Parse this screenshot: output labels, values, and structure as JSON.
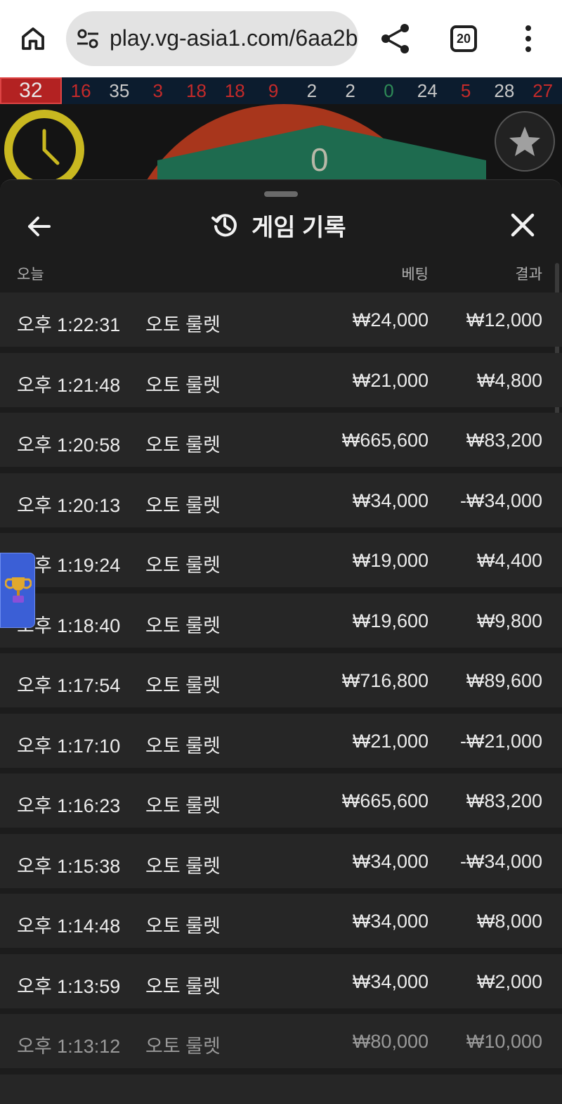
{
  "browser": {
    "url": "play.vg-asia1.com/6aa2b",
    "tab_count": "20"
  },
  "results_strip": {
    "latest": "32",
    "numbers": [
      {
        "value": "16",
        "color": "red"
      },
      {
        "value": "35",
        "color": "black"
      },
      {
        "value": "3",
        "color": "red"
      },
      {
        "value": "18",
        "color": "red"
      },
      {
        "value": "18",
        "color": "red"
      },
      {
        "value": "9",
        "color": "red"
      },
      {
        "value": "2",
        "color": "black"
      },
      {
        "value": "2",
        "color": "black"
      },
      {
        "value": "0",
        "color": "green"
      },
      {
        "value": "24",
        "color": "black"
      },
      {
        "value": "5",
        "color": "red"
      },
      {
        "value": "28",
        "color": "black"
      },
      {
        "value": "27",
        "color": "red"
      }
    ]
  },
  "game": {
    "zero_label": "0"
  },
  "panel": {
    "title": "게임 기록",
    "columns": {
      "date": "오늘",
      "bet": "베팅",
      "result": "결과"
    },
    "rows": [
      {
        "time": "오후 1:22:31",
        "game": "오토 룰렛",
        "bet": "₩24,000",
        "result": "₩12,000"
      },
      {
        "time": "오후 1:21:48",
        "game": "오토 룰렛",
        "bet": "₩21,000",
        "result": "₩4,800"
      },
      {
        "time": "오후 1:20:58",
        "game": "오토 룰렛",
        "bet": "₩665,600",
        "result": "₩83,200"
      },
      {
        "time": "오후 1:20:13",
        "game": "오토 룰렛",
        "bet": "₩34,000",
        "result": "-₩34,000"
      },
      {
        "time": "오후 1:19:24",
        "game": "오토 룰렛",
        "bet": "₩19,000",
        "result": "₩4,400"
      },
      {
        "time": "오후 1:18:40",
        "game": "오토 룰렛",
        "bet": "₩19,600",
        "result": "₩9,800"
      },
      {
        "time": "오후 1:17:54",
        "game": "오토 룰렛",
        "bet": "₩716,800",
        "result": "₩89,600"
      },
      {
        "time": "오후 1:17:10",
        "game": "오토 룰렛",
        "bet": "₩21,000",
        "result": "-₩21,000"
      },
      {
        "time": "오후 1:16:23",
        "game": "오토 룰렛",
        "bet": "₩665,600",
        "result": "₩83,200"
      },
      {
        "time": "오후 1:15:38",
        "game": "오토 룰렛",
        "bet": "₩34,000",
        "result": "-₩34,000"
      },
      {
        "time": "오후 1:14:48",
        "game": "오토 룰렛",
        "bet": "₩34,000",
        "result": "₩8,000"
      },
      {
        "time": "오후 1:13:59",
        "game": "오토 룰렛",
        "bet": "₩34,000",
        "result": "₩2,000"
      },
      {
        "time": "오후 1:13:12",
        "game": "오토 룰렛",
        "bet": "₩80,000",
        "result": "₩10,000"
      }
    ]
  },
  "colors": {
    "red": "#c42a2a",
    "black": "#c8c8c8",
    "green": "#2e8b57",
    "accent": "#3b5fd6"
  }
}
